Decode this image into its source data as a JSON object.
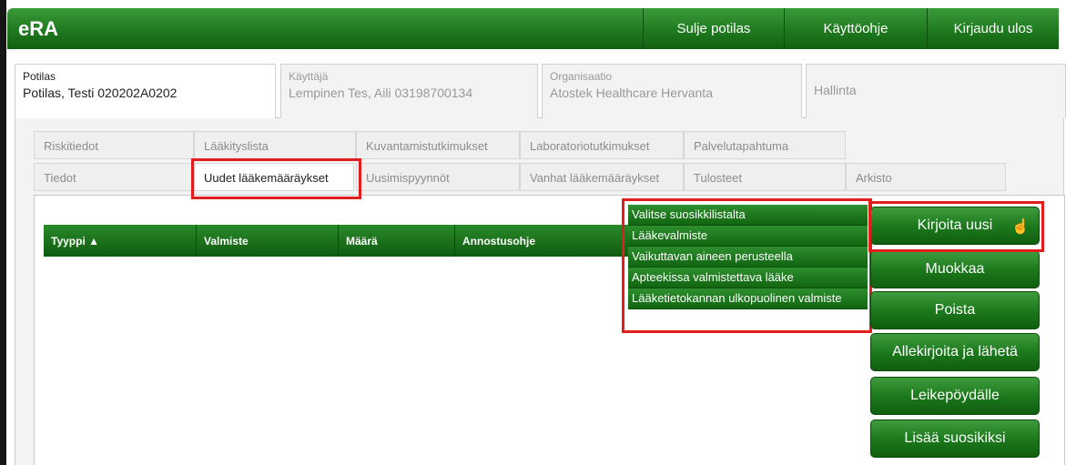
{
  "app": {
    "title": "eRA"
  },
  "header": {
    "buttons": [
      "Sulje potilas",
      "Käyttöohje",
      "Kirjaudu ulos"
    ]
  },
  "info_tabs": [
    {
      "label": "Potilas",
      "value": "Potilas, Testi 020202A0202"
    },
    {
      "label": "Käyttäjä",
      "value": "Lempinen Tes, Aili 03198700134"
    },
    {
      "label": "Organisaatio",
      "value": "Atostek Healthcare Hervanta"
    },
    {
      "label": "Hallinta"
    }
  ],
  "nav_row1": [
    "Riskitiedot",
    "Lääkityslista",
    "Kuvantamistutkimukset",
    "Laboratoriotutkimukset",
    "Palvelutapahtuma"
  ],
  "nav_row2": [
    "Tiedot",
    "Uudet lääkemääräykset",
    "Uusimispyynnöt",
    "Vanhat lääkemääräykset",
    "Tulosteet",
    "Arkisto"
  ],
  "table": {
    "columns": [
      "Tyyppi ▲",
      "Valmiste",
      "Määrä",
      "Annostusohje"
    ]
  },
  "dropdown": {
    "items": [
      "Valitse suosikkilistalta",
      "Lääkevalmiste",
      "Vaikuttavan aineen perusteella",
      "Apteekissa valmistettava lääke",
      "Lääketietokannan ulkopuolinen valmiste"
    ]
  },
  "actions": [
    "Kirjoita uusi",
    "Muokkaa",
    "Poista",
    "Allekirjoita ja lähetä",
    "Leikepöydälle",
    "Lisää suosikiksi"
  ],
  "colors": {
    "header_green": "#1f7a1f",
    "highlight_red": "#e11d1d"
  }
}
